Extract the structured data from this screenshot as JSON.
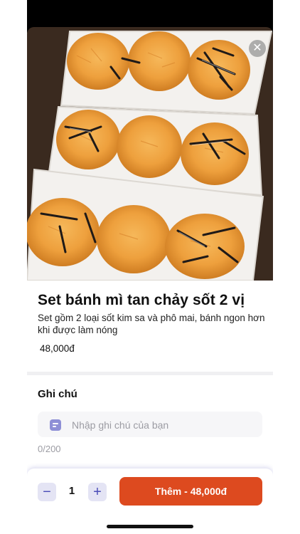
{
  "product": {
    "title": "Set bánh mì tan chảy sốt 2 vị",
    "description": "Set gồm 2 loại sốt kim sa và phô mai, bánh ngon hơn khi được làm nóng",
    "price": "48,000đ",
    "image_icon": "product-photo",
    "close_icon": "✕"
  },
  "note": {
    "label": "Ghi chú",
    "placeholder": "Nhập ghi chú của bạn",
    "value": "",
    "counter": "0/200"
  },
  "cart": {
    "minus": "−",
    "quantity": "1",
    "plus": "+",
    "add_label": "Thêm - 48,000đ"
  },
  "colors": {
    "accent": "#dd4a1f",
    "qty_button_bg": "#e4e4f4",
    "qty_button_fg": "#4a4cb8",
    "note_icon": "#8e8fd6"
  }
}
